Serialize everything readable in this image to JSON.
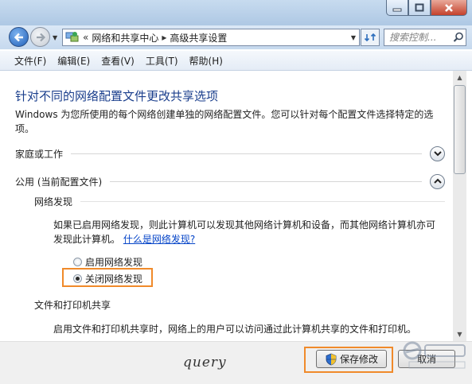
{
  "navigation": {
    "breadcrumb": [
      "网络和共享中心",
      "高级共享设置"
    ],
    "search_placeholder": "搜索控制..."
  },
  "menu": [
    "文件(F)",
    "编辑(E)",
    "查看(V)",
    "工具(T)",
    "帮助(H)"
  ],
  "page": {
    "heading": "针对不同的网络配置文件更改共享选项",
    "description": "Windows 为您所使用的每个网络创建单独的网络配置文件。您可以针对每个配置文件选择特定的选项。",
    "sections": {
      "home_work": "家庭或工作",
      "public": "公用 (当前配置文件)"
    },
    "network_discovery": {
      "title": "网络发现",
      "text": "如果已启用网络发现，则此计算机可以发现其他网络计算机和设备，而其他网络计算机亦可发现此计算机。",
      "link": "什么是网络发现?",
      "options": [
        "启用网络发现",
        "关闭网络发现"
      ],
      "selected": "关闭网络发现"
    },
    "file_printer_sharing": {
      "title": "文件和打印机共享",
      "text": "启用文件和打印机共享时，网络上的用户可以访问通过此计算机共享的文件和打印机。"
    }
  },
  "buttons": {
    "save": "保存修改",
    "cancel": "取消"
  },
  "signature": "query",
  "colors": {
    "heading": "#1a3e8c",
    "link": "#0645c8",
    "highlight": "#f08a2a"
  }
}
